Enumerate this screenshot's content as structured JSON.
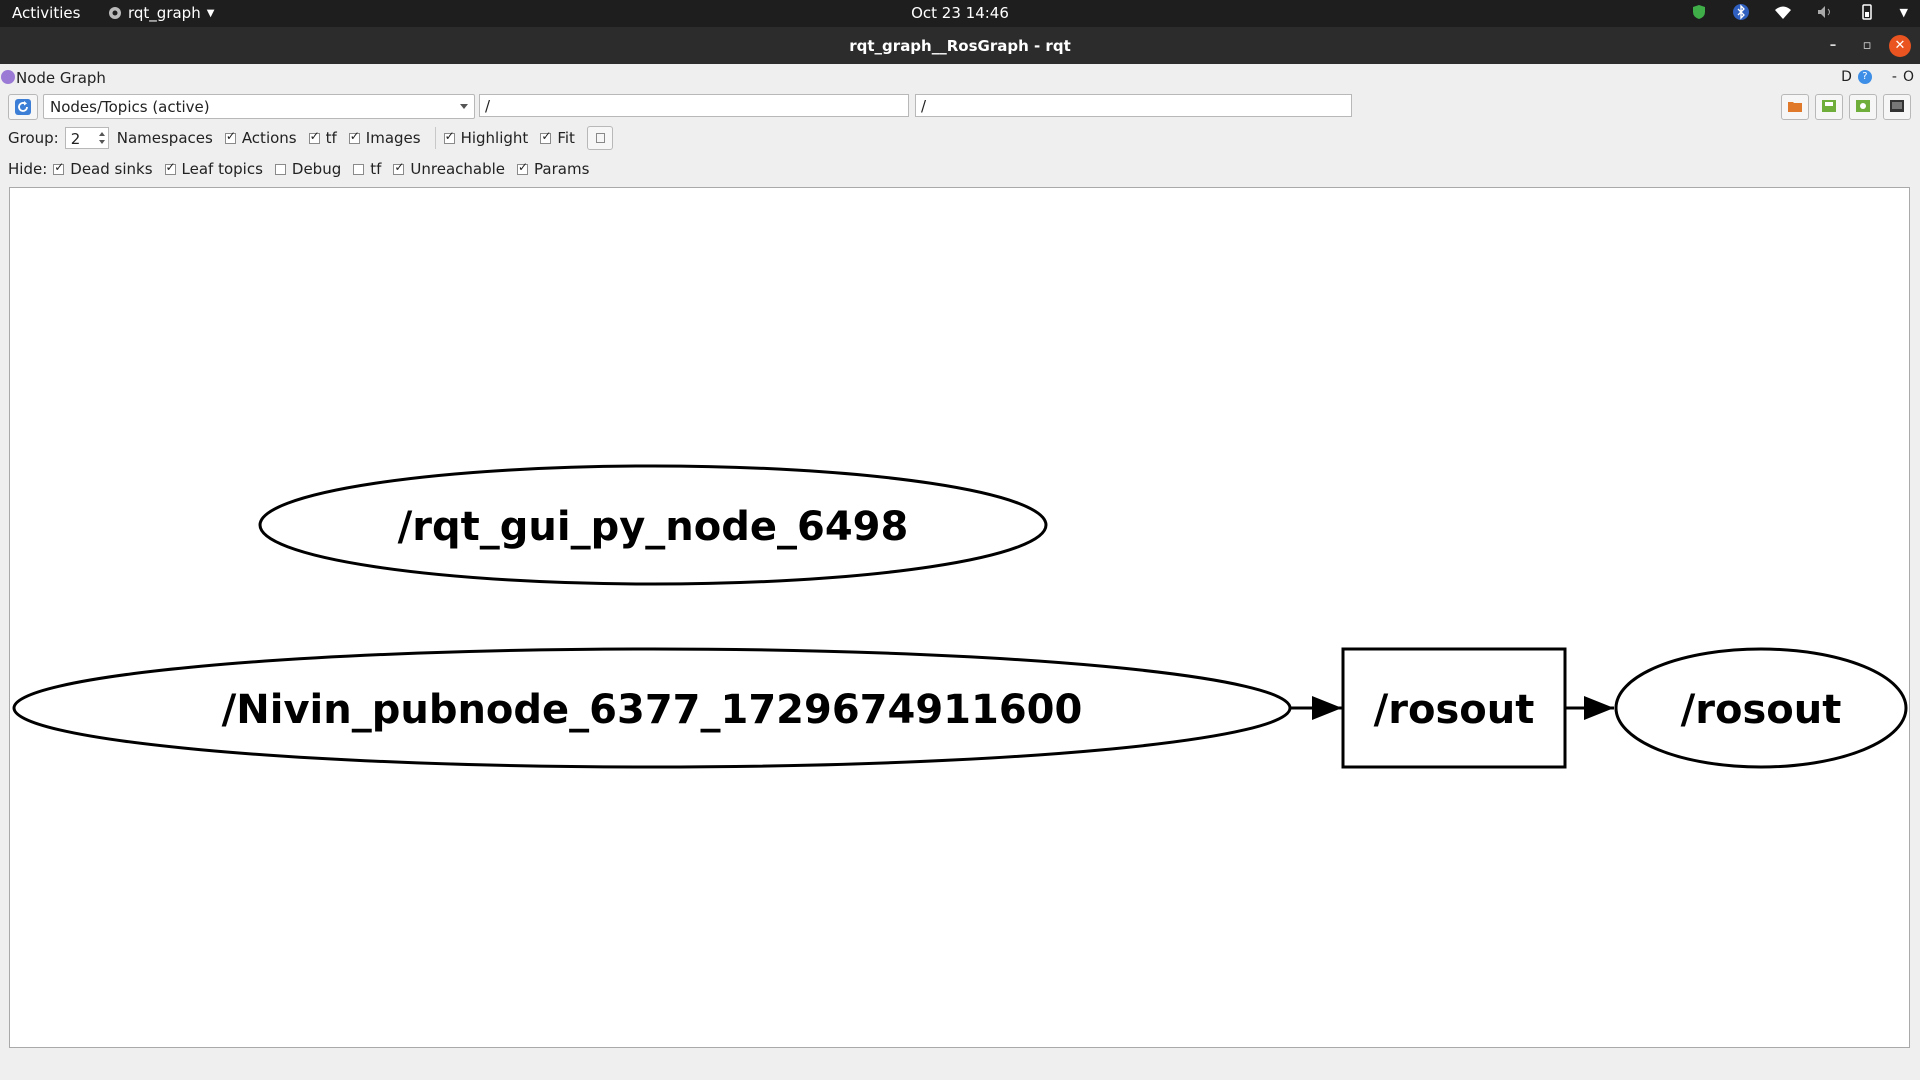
{
  "topbar": {
    "activities": "Activities",
    "app_name": "rqt_graph",
    "clock": "Oct 23  14:46",
    "tray_icons": [
      "shield-icon",
      "bluetooth-icon",
      "wifi-icon",
      "volume-muted-icon",
      "battery-icon",
      "dropdown-arrow-icon"
    ]
  },
  "window": {
    "title": "rqt_graph__RosGraph - rqt",
    "controls": [
      "minimize",
      "restore",
      "close"
    ]
  },
  "plugin": {
    "title": "Node Graph",
    "header_right_letter": "D",
    "help": "?",
    "minimize": "-",
    "close": "O"
  },
  "toolbar": {
    "graph_type": "Nodes/Topics (active)",
    "ns_filter": "/",
    "topic_filter": "/",
    "right_buttons": [
      "load-dot-icon",
      "save-dot-icon",
      "save-image-icon",
      "screenshot-icon"
    ]
  },
  "options": {
    "group_label": "Group:",
    "group_value": "2",
    "checks": [
      {
        "label": "Namespaces",
        "checked": false
      },
      {
        "label": "Actions",
        "checked": true
      },
      {
        "label": "tf",
        "checked": true
      },
      {
        "label": "Images",
        "checked": true
      },
      {
        "label": "Highlight",
        "checked": true
      },
      {
        "label": "Fit",
        "checked": true
      }
    ]
  },
  "hide": {
    "label": "Hide:",
    "checks": [
      {
        "label": "Dead sinks",
        "checked": true
      },
      {
        "label": "Leaf topics",
        "checked": true
      },
      {
        "label": "Debug",
        "checked": false
      },
      {
        "label": "tf",
        "checked": false
      },
      {
        "label": "Unreachable",
        "checked": true
      },
      {
        "label": "Params",
        "checked": true
      }
    ]
  },
  "graph": {
    "nodes": [
      {
        "id": "rqt_gui",
        "label": "/rqt_gui_py_node_6498",
        "shape": "ellipse"
      },
      {
        "id": "pubnode",
        "label": "/Nivin_pubnode_6377_1729674911600",
        "shape": "ellipse"
      },
      {
        "id": "rosout_topic",
        "label": "/rosout",
        "shape": "box"
      },
      {
        "id": "rosout_node",
        "label": "/rosout",
        "shape": "ellipse"
      }
    ],
    "edges": [
      {
        "from": "pubnode",
        "to": "rosout_topic"
      },
      {
        "from": "rosout_topic",
        "to": "rosout_node"
      }
    ]
  }
}
